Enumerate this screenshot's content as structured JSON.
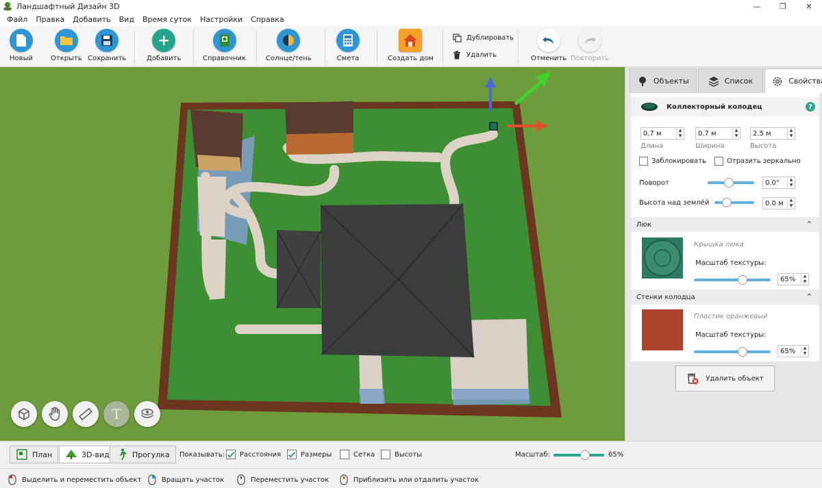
{
  "window": {
    "title": "Ландшафтный Дизайн 3D",
    "minimize": "—",
    "maximize": "❐",
    "close": "✕"
  },
  "menu": [
    "Файл",
    "Правка",
    "Добавить",
    "Вид",
    "Время суток",
    "Настройки",
    "Справка"
  ],
  "toolbar": {
    "new": "Новый",
    "open": "Открыть",
    "save": "Сохранить",
    "add": "Добавить",
    "reference": "Справочник",
    "sun_shadow": "Солнце/тень",
    "estimate": "Смета",
    "create_house": "Создать дом",
    "duplicate": "Дублировать",
    "delete": "Удалить",
    "undo": "Отменить",
    "redo": "Повторить"
  },
  "tabs": {
    "objects": "Объекты",
    "list": "Список",
    "properties": "Свойства"
  },
  "properties": {
    "object_name": "Коллекторный колодец",
    "help": "?",
    "length": {
      "value": "0.7 м",
      "caption": "Длина"
    },
    "width": {
      "value": "0.7 м",
      "caption": "Ширина"
    },
    "height": {
      "value": "2.5 м",
      "caption": "Высота"
    },
    "lock_label": "Заблокировать",
    "mirror_label": "Отразить зеркально",
    "rotation_label": "Поворот",
    "rotation_value": "0.0°",
    "rotation_level": 0.45,
    "elevation_label": "Высота над землёй",
    "elevation_value": "0.0 м",
    "elevation_level": 0.25,
    "hatch_section": "Люк",
    "hatch_texture": "Крышка люка",
    "hatch_scale_label": "Масштаб текстуры:",
    "hatch_scale_value": "65%",
    "walls_section": "Стенки колодца",
    "walls_texture": "Пластик оранжевый",
    "walls_scale_label": "Масштаб текстуры:",
    "walls_scale_value": "65%",
    "delete_object": "Удалить объект"
  },
  "view_modes": {
    "plan": "План",
    "view3d": "3D-вид",
    "walk": "Прогулка"
  },
  "show": {
    "label": "Показывать:",
    "distances": {
      "label": "Расстояния",
      "checked": true
    },
    "sizes": {
      "label": "Размеры",
      "checked": true
    },
    "grid": {
      "label": "Сетка",
      "checked": false
    },
    "heights": {
      "label": "Высоты",
      "checked": false
    }
  },
  "zoom": {
    "label": "Масштаб:",
    "value": "65%",
    "level": 0.65
  },
  "hints": {
    "select_move": "Выделить и переместить объект",
    "rotate": "Вращать участок",
    "pan": "Переместить участок",
    "zoom": "Приблизить или отдалить участок"
  },
  "colors": {
    "accent": "#2aa690",
    "slider": "#5fb2e0",
    "check": "#24a38d",
    "grass": "#6e9a3c"
  }
}
